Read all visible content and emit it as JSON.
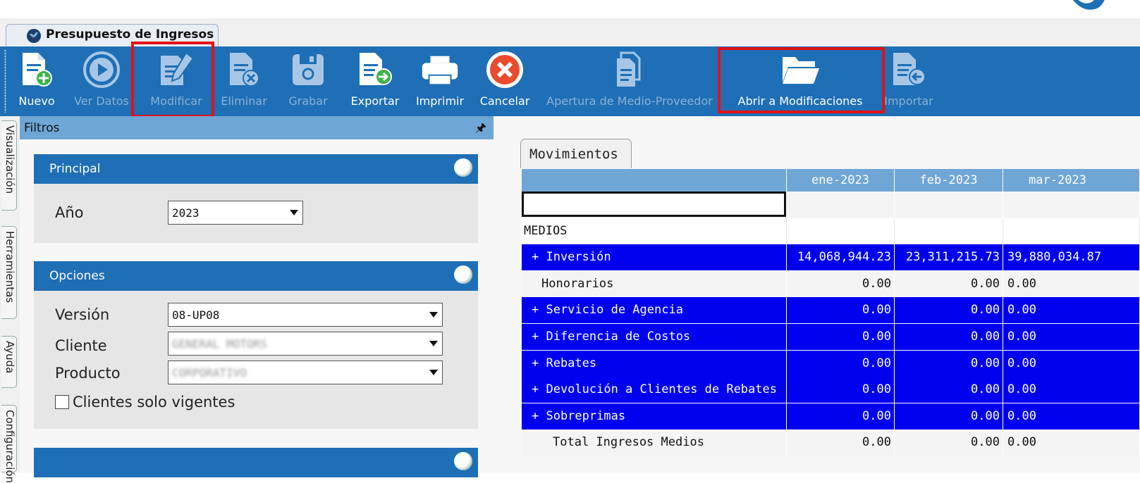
{
  "document_tab": {
    "title": "Presupuesto de Ingresos"
  },
  "toolbar": {
    "buttons": [
      {
        "id": "nuevo",
        "label": "Nuevo",
        "icon": "new-document-plus-icon",
        "enabled": true
      },
      {
        "id": "ver_datos",
        "label": "Ver Datos",
        "icon": "play-circle-icon",
        "enabled": false
      },
      {
        "id": "modificar",
        "label": "Modificar",
        "icon": "document-pencil-icon",
        "enabled": false
      },
      {
        "id": "eliminar",
        "label": "Eliminar",
        "icon": "document-delete-icon",
        "enabled": false
      },
      {
        "id": "grabar",
        "label": "Grabar",
        "icon": "save-disk-icon",
        "enabled": false
      },
      {
        "id": "exportar",
        "label": "Exportar",
        "icon": "document-export-arrow-icon",
        "enabled": true
      },
      {
        "id": "imprimir",
        "label": "Imprimir",
        "icon": "printer-icon",
        "enabled": true
      },
      {
        "id": "cancelar",
        "label": "Cancelar",
        "icon": "cancel-x-circle-icon",
        "enabled": true
      },
      {
        "id": "apertura",
        "label": "Apertura de Medio-Proveedor",
        "icon": "document-copy-icon",
        "enabled": false
      },
      {
        "id": "abrir_mod",
        "label": "Abrir a Modificaciones",
        "icon": "open-folder-icon",
        "enabled": true
      },
      {
        "id": "importar",
        "label": "Importar",
        "icon": "document-import-arrow-icon",
        "enabled": false
      }
    ]
  },
  "side_tabs": [
    "Visualización",
    "Herramientas",
    "Ayuda",
    "Configuración"
  ],
  "filters": {
    "title": "Filtros",
    "principal": {
      "title": "Principal",
      "anio_label": "Año",
      "anio_value": "2023"
    },
    "opciones": {
      "title": "Opciones",
      "version_label": "Versión",
      "version_value": "08-UP08",
      "cliente_label": "Cliente",
      "cliente_value": "GENERAL MOTORS",
      "producto_label": "Producto",
      "producto_value": "CORPORATIVO",
      "solo_vigentes_label": "Clientes solo vigentes",
      "solo_vigentes_checked": false
    }
  },
  "movimientos": {
    "tab_label": "Movimientos",
    "columns": [
      "ene-2023",
      "feb-2023",
      "mar-2023"
    ],
    "rows": [
      {
        "label": "",
        "values": [
          "",
          "",
          ""
        ],
        "style": "plain"
      },
      {
        "label": "MEDIOS",
        "values": [
          "",
          "",
          ""
        ],
        "style": "white"
      },
      {
        "label": "+ Inversión",
        "values": [
          "14,068,944.23",
          "23,311,215.73",
          "39,880,034.87"
        ],
        "style": "blue"
      },
      {
        "label": "Honorarios",
        "values": [
          "0.00",
          "0.00",
          "0.00"
        ],
        "style": "plain"
      },
      {
        "label": "+ Servicio de Agencia",
        "values": [
          "0.00",
          "0.00",
          "0.00"
        ],
        "style": "blue"
      },
      {
        "label": "+ Diferencia de Costos",
        "values": [
          "0.00",
          "0.00",
          "0.00"
        ],
        "style": "blue"
      },
      {
        "label": "+ Rebates",
        "values": [
          "0.00",
          "0.00",
          "0.00"
        ],
        "style": "blue"
      },
      {
        "label": "+ Devolución a Clientes de Rebates",
        "values": [
          "0.00",
          "0.00",
          "0.00"
        ],
        "style": "blue"
      },
      {
        "label": "+ Sobreprimas",
        "values": [
          "0.00",
          "0.00",
          "0.00"
        ],
        "style": "blue"
      },
      {
        "label": "Total Ingresos Medios",
        "values": [
          "0.00",
          "0.00",
          "0.00"
        ],
        "style": "plain"
      }
    ]
  },
  "colors": {
    "toolbar_bg": "#1e6fb5",
    "highlight_row": "#0000ee",
    "header_light": "#6fa6d6",
    "annotation_red": "#e0121a"
  }
}
